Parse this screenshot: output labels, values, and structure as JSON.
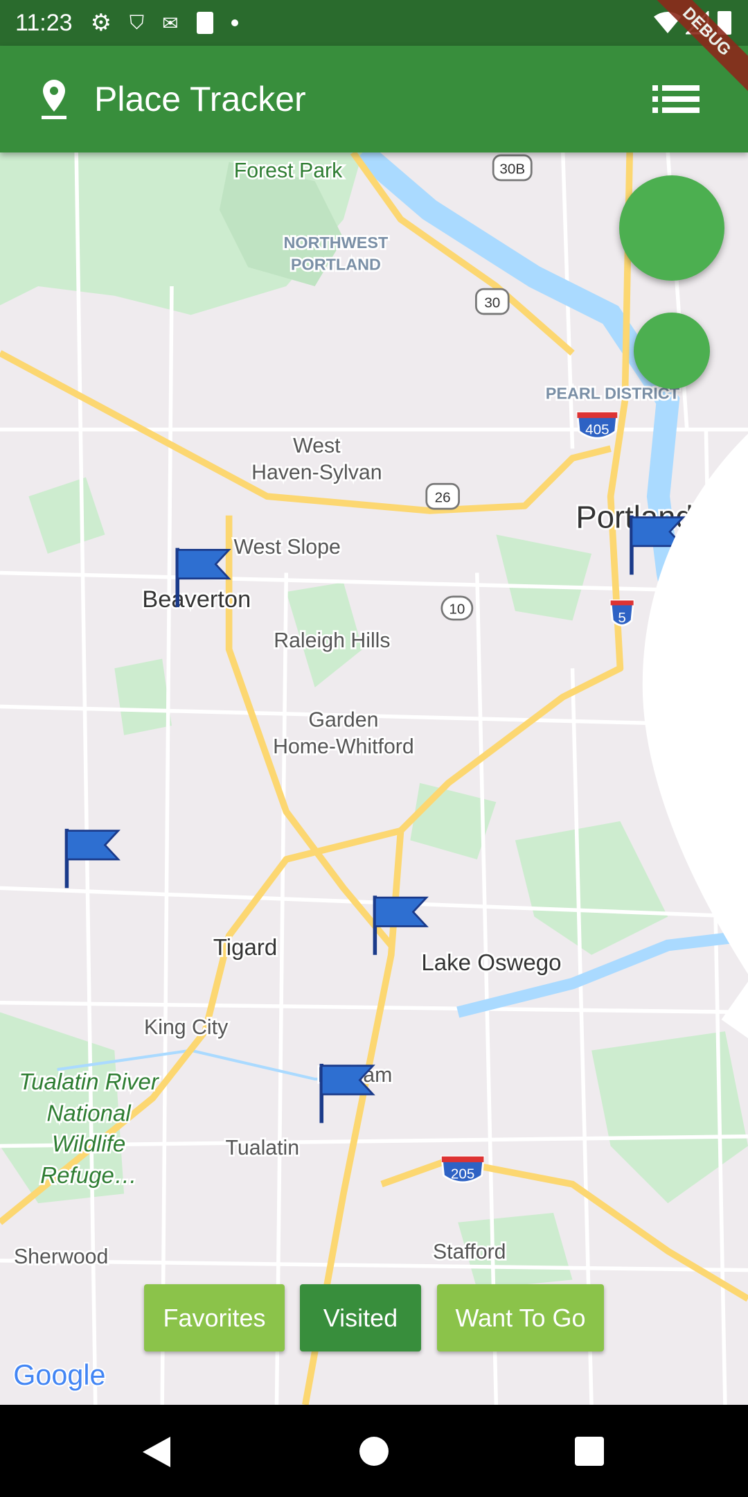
{
  "status_bar": {
    "time": "11:23",
    "icons": [
      "gear-icon",
      "shield-play-icon",
      "gmail-icon",
      "sd-card-icon",
      "dot-icon",
      "wifi-icon",
      "signal-icon",
      "battery-icon"
    ]
  },
  "debug_banner": "DEBUG",
  "app_bar": {
    "title": "Place Tracker",
    "leading_icon": "place-pin-icon",
    "action_icon": "list-icon"
  },
  "fabs": {
    "add_place": "add-location-icon",
    "map_type": "layers-icon"
  },
  "colors": {
    "app_bar": "#388e3c",
    "status_bar": "#2a6b2d",
    "fab": "#4caf50",
    "button_selected": "#388e3c",
    "button_unselected": "#8bc34a",
    "flag": "#2e6fd1"
  },
  "map": {
    "labels": {
      "forest_park": "Forest Park",
      "nw1": "NORTHWEST",
      "nw2": "PORTLAND",
      "pearl": "PEARL DISTRICT",
      "whs1": "West",
      "whs2": "Haven-Sylvan",
      "west_slope": "West Slope",
      "beaverton": "Beaverton",
      "portland": "Portland",
      "raleigh": "Raleigh Hills",
      "gh1": "Garden",
      "gh2": "Home-Whitford",
      "tigard": "Tigard",
      "lake_oswego": "Lake Oswego",
      "king_city": "King City",
      "tr1": "Tualatin River",
      "tr2": "National",
      "tr3": "Wildlife",
      "tr4": "Refuge…",
      "durham": "Durham",
      "tualatin": "Tualatin",
      "sherwood": "Sherwood",
      "stafford": "Stafford"
    },
    "shields": {
      "s30b": "30B",
      "s30": "30",
      "s405": "405",
      "s26": "26",
      "s10": "10",
      "s5": "5",
      "s205": "205"
    },
    "attribution": "Google"
  },
  "filter_buttons": [
    {
      "label": "Favorites",
      "selected": false
    },
    {
      "label": "Visited",
      "selected": true
    },
    {
      "label": "Want To Go",
      "selected": false
    }
  ]
}
